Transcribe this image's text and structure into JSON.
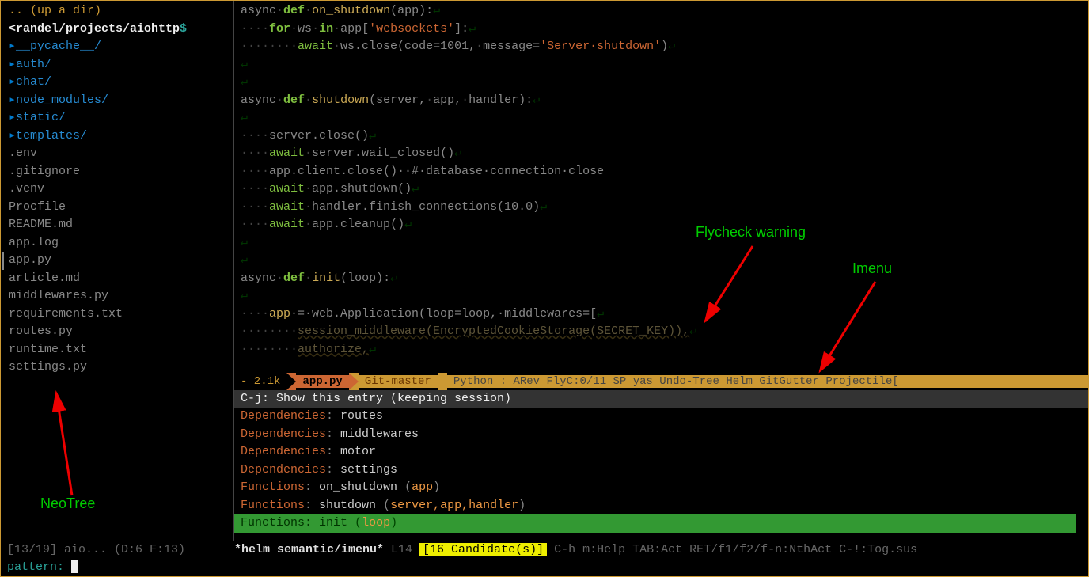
{
  "sidebar": {
    "updir": ".. (up a dir)",
    "path_prefix": "<randel/projects/aiohttp",
    "path_suffix": "$",
    "folders": [
      "__pycache__/",
      "auth/",
      "chat/",
      "node_modules/",
      "static/",
      "templates/"
    ],
    "files": [
      ".env",
      ".gitignore",
      ".venv",
      "Procfile",
      "README.md",
      "app.log",
      "app.py",
      "article.md",
      "middlewares.py",
      "requirements.txt",
      "routes.py",
      "runtime.txt",
      "settings.py"
    ],
    "highlighted_file_index": 6,
    "status": "[13/19] aio... (D:6 F:13)"
  },
  "code": {
    "lines": [
      {
        "parts": [
          "async·",
          "def·",
          "on_shutdown",
          "(app):"
        ]
      },
      {
        "indent": 4,
        "parts": [
          "for·",
          "ws·",
          "in·",
          "app[",
          "'websockets'",
          "]:"
        ]
      },
      {
        "indent": 8,
        "parts": [
          "await·",
          "ws.close(code=1001,·message=",
          "'Server·shutdown'",
          ")"
        ]
      },
      {
        "empty": true
      },
      {
        "empty": true
      },
      {
        "parts": [
          "async·",
          "def·",
          "shutdown",
          "(server,·app,·handler):"
        ]
      },
      {
        "empty": true
      },
      {
        "indent": 4,
        "plain": "server.close()"
      },
      {
        "indent": 4,
        "parts": [
          "await·",
          "server.wait_closed()"
        ]
      },
      {
        "indent": 4,
        "plain_comment": [
          "app.client.close()··",
          "#·database·connection·close"
        ]
      },
      {
        "indent": 4,
        "parts": [
          "await·",
          "app.shutdown()"
        ]
      },
      {
        "indent": 4,
        "parts": [
          "await·",
          "handler.finish_connections(10.0)"
        ]
      },
      {
        "indent": 4,
        "parts": [
          "await·",
          "app.cleanup()"
        ]
      },
      {
        "empty": true
      },
      {
        "empty": true
      },
      {
        "parts": [
          "async·",
          "def·",
          "init",
          "(loop):"
        ]
      },
      {
        "empty": true
      },
      {
        "indent": 4,
        "assign": [
          "app",
          "·=·web.Application(loop=loop,·middlewares=["
        ]
      },
      {
        "indent": 8,
        "warn": "session_middleware(EncryptedCookieStorage(SECRET_KEY)),"
      },
      {
        "indent": 8,
        "warn": "authorize,"
      }
    ]
  },
  "modeline": {
    "size": "- 2.1k",
    "filename": "app.py",
    "git": "Git-master",
    "rest": "Python : ARev FlyC:0/11 SP yas Undo-Tree Helm GitGutter Projectile["
  },
  "helm": {
    "header": "C-j: Show this entry (keeping session)",
    "deps": [
      "routes",
      "middlewares",
      "motor",
      "settings"
    ],
    "funcs": [
      {
        "name": "on_shutdown",
        "args": "app"
      },
      {
        "name": "shutdown",
        "args": "server,app,handler"
      },
      {
        "name": "init",
        "args": "loop",
        "selected": true
      }
    ],
    "status_mode": "*helm semantic/imenu*",
    "status_line": " L14 ",
    "candidate": "[16 Candidate(s)]",
    "status_help": " C-h m:Help TAB:Act RET/f1/f2/f-n:NthAct C-!:Tog.sus"
  },
  "minibuffer": {
    "prompt": "pattern: "
  },
  "annotations": {
    "flycheck": "Flycheck warning",
    "imenu": "Imenu",
    "neotree": "NeoTree"
  }
}
